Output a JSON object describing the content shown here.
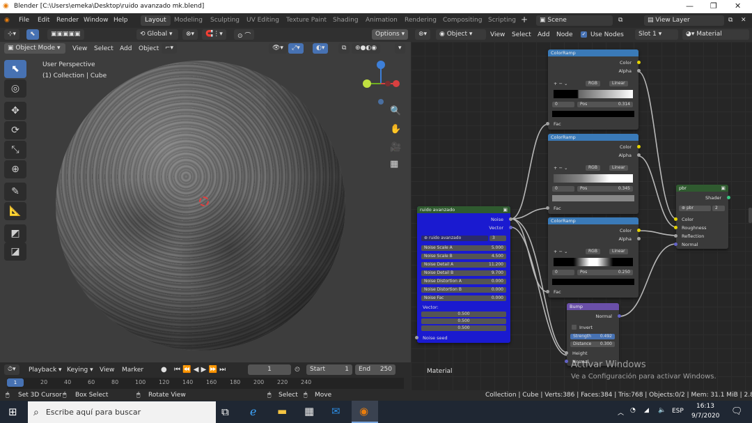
{
  "window": {
    "title": "Blender [C:\\Users\\emeka\\Desktop\\ruido avanzado mk.blend]"
  },
  "menu": {
    "items": [
      "File",
      "Edit",
      "Render",
      "Window",
      "Help"
    ]
  },
  "workspaces": [
    "Layout",
    "Modeling",
    "Sculpting",
    "UV Editing",
    "Texture Paint",
    "Shading",
    "Animation",
    "Rendering",
    "Compositing",
    "Scripting"
  ],
  "scene": {
    "label": "Scene",
    "view_layer": "View Layer"
  },
  "viewport": {
    "transform": "Global",
    "options": "Options",
    "mode": "Object Mode",
    "menus": [
      "View",
      "Select",
      "Add",
      "Object"
    ],
    "persp": "User Perspective",
    "collection": "(1) Collection | Cube"
  },
  "node_header": {
    "type": "Object",
    "menus": [
      "View",
      "Select",
      "Add",
      "Node"
    ],
    "use_nodes": "Use Nodes",
    "slot": "Slot 1",
    "material": "Material"
  },
  "nodes": {
    "colorramp1": {
      "title": "ColorRamp",
      "out1": "Color",
      "out2": "Alpha",
      "mode": "RGB",
      "interp": "Linear",
      "index": "0",
      "pos_label": "Pos",
      "pos": "0.314",
      "in": "Fac"
    },
    "colorramp2": {
      "title": "ColorRamp",
      "out1": "Color",
      "out2": "Alpha",
      "mode": "RGB",
      "interp": "Linear",
      "index": "0",
      "pos_label": "Pos",
      "pos": "0.345",
      "in": "Fac"
    },
    "colorramp3": {
      "title": "ColorRamp",
      "out1": "Color",
      "out2": "Alpha",
      "mode": "RGB",
      "interp": "Linear",
      "index": "0",
      "pos_label": "Pos",
      "pos": "0.250",
      "in": "Fac"
    },
    "group": {
      "title": "ruido avanzado",
      "out1": "Noise",
      "out2": "Vector",
      "name": "ruido avanzado",
      "users": "3",
      "fields": [
        [
          "Noise Scale A",
          "5.000"
        ],
        [
          "Noise Scale B",
          "4.500"
        ],
        [
          "Noise Detail A",
          "11.200"
        ],
        [
          "Noise Detail B",
          "9.700"
        ],
        [
          "Noise Distortion A",
          "0.000"
        ],
        [
          "Noise Distortion B",
          "0.000"
        ],
        [
          "Noise Fac",
          "0.000"
        ]
      ],
      "vector_label": "Vector:",
      "vector": [
        "0.500",
        "0.500",
        "0.500"
      ],
      "seed": "Noise seed"
    },
    "pbr": {
      "title": "pbr",
      "out": "Shader",
      "name": "pbr",
      "users": "2",
      "inputs": [
        "Color",
        "Roughness",
        "Reflection",
        "Normal"
      ]
    },
    "bump": {
      "title": "Bump",
      "out": "Normal",
      "invert": "Invert",
      "strength_label": "Strength",
      "strength": "0.492",
      "distance_label": "Distance",
      "distance": "0.300",
      "height": "Height",
      "normal": "Normal"
    }
  },
  "node_footer": {
    "material": "Material"
  },
  "watermark": {
    "line1": "Activar Windows",
    "line2": "Ve a Configuración para activar Windows."
  },
  "timeline": {
    "menus": [
      "Playback",
      "Keying",
      "View",
      "Marker"
    ],
    "current": "1",
    "start_label": "Start",
    "start": "1",
    "end_label": "End",
    "end": "250",
    "ticks": [
      "0",
      "20",
      "40",
      "60",
      "80",
      "100",
      "120",
      "140",
      "160",
      "180",
      "200",
      "220",
      "240"
    ]
  },
  "status": {
    "left": [
      "Set 3D Cursor",
      "Box Select",
      "Rotate View"
    ],
    "mid": [
      "Select",
      "Move"
    ],
    "stats": "Collection | Cube | Verts:386 | Faces:384 | Tris:768 | Objects:0/2 | Mem: 31.1 MiB | 2.83.1"
  },
  "taskbar": {
    "search": "Escribe aquí para buscar",
    "lang": "ESP",
    "time": "16:13",
    "date": "9/7/2020"
  },
  "colors": {
    "accent": "#4772b3",
    "group_node": "#1a1ad0",
    "colorramp_header": "#3a7ab8",
    "bump_header": "#6a4fa8",
    "pbr_header": "#2f5a2f"
  }
}
